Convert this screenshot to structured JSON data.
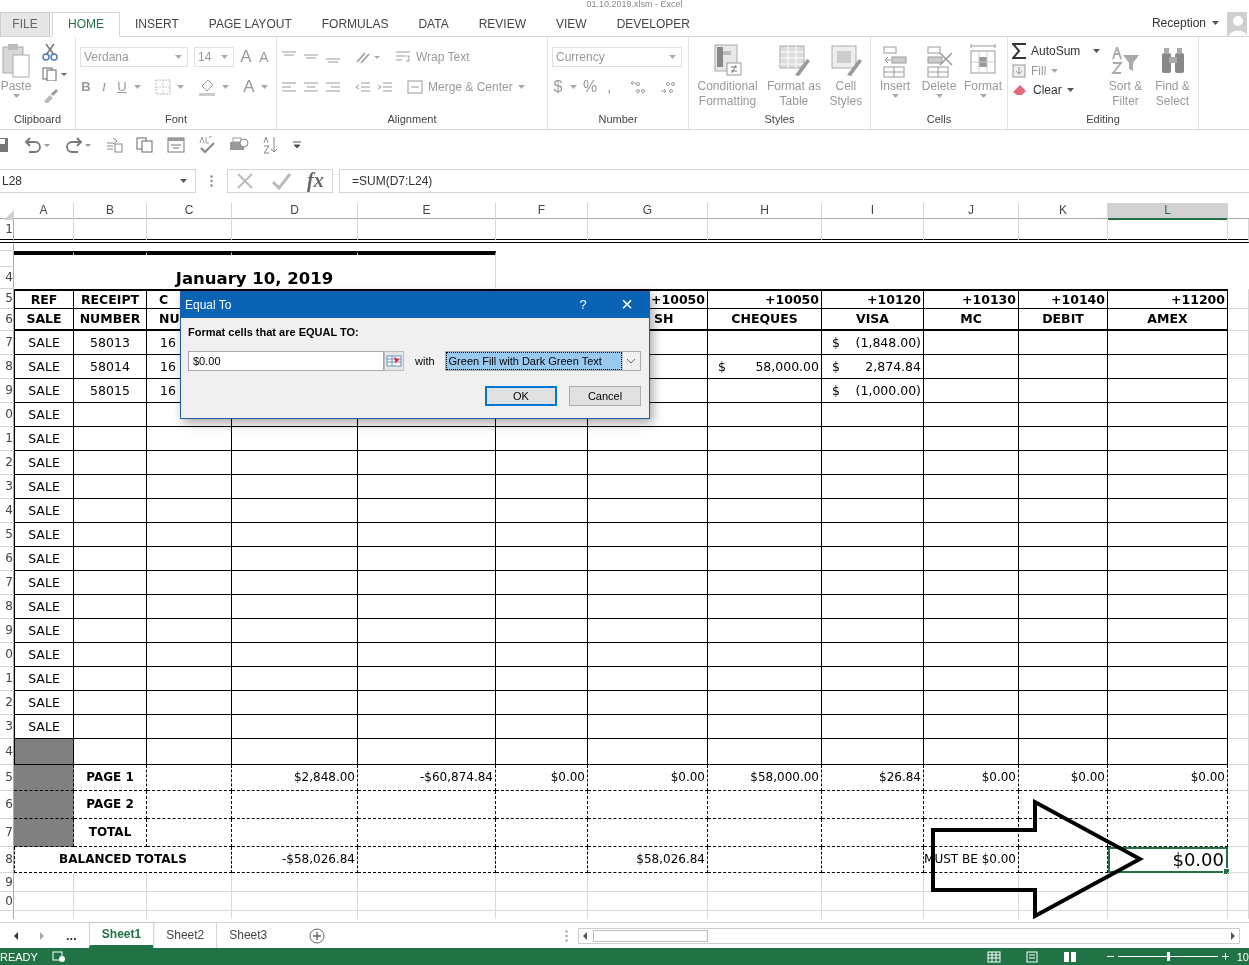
{
  "title_bar": {
    "title": "01.10.2019.xlsm - Excel"
  },
  "tabs": [
    {
      "label": "FILE",
      "selected": false
    },
    {
      "label": "HOME",
      "selected": true
    },
    {
      "label": "INSERT",
      "selected": false
    },
    {
      "label": "PAGE LAYOUT",
      "selected": false
    },
    {
      "label": "FORMULAS",
      "selected": false
    },
    {
      "label": "DATA",
      "selected": false
    },
    {
      "label": "REVIEW",
      "selected": false
    },
    {
      "label": "VIEW",
      "selected": false
    },
    {
      "label": "DEVELOPER",
      "selected": false
    }
  ],
  "account": {
    "name": "Reception"
  },
  "ribbon": {
    "clipboard": {
      "label": "Clipboard",
      "paste": "Paste"
    },
    "font": {
      "label": "Font",
      "family": "Verdana",
      "size": "14",
      "grow": "A",
      "shrink": "A",
      "bold": "B",
      "italic": "I",
      "underline": "U",
      "swatch_letter": "A"
    },
    "alignment": {
      "label": "Alignment",
      "wrap": "Wrap Text",
      "merge": "Merge & Center"
    },
    "number": {
      "label": "Number",
      "format": "Currency",
      "currency": "$",
      "percent": "%",
      "comma": ","
    },
    "styles": {
      "label": "Styles",
      "conditional": "Conditional Formatting",
      "table": "Format as Table",
      "cell_styles": "Cell Styles"
    },
    "cells": {
      "label": "Cells",
      "insert": "Insert",
      "delete": "Delete",
      "format": "Format"
    },
    "editing": {
      "label": "Editing",
      "autosum": "AutoSum",
      "fill": "Fill",
      "clear": "Clear",
      "sort": "Sort & Filter",
      "find": "Find & Select"
    }
  },
  "formula_bar": {
    "name_box": "L28",
    "fx": "fx",
    "formula": "=SUM(D7:L24)"
  },
  "columns": [
    {
      "label": "A",
      "selected": false
    },
    {
      "label": "B",
      "selected": false
    },
    {
      "label": "C",
      "selected": false
    },
    {
      "label": "D",
      "selected": false
    },
    {
      "label": "E",
      "selected": false
    },
    {
      "label": "F",
      "selected": false
    },
    {
      "label": "G",
      "selected": false
    },
    {
      "label": "H",
      "selected": false
    },
    {
      "label": "I",
      "selected": false
    },
    {
      "label": "J",
      "selected": false
    },
    {
      "label": "K",
      "selected": false
    },
    {
      "label": "L",
      "selected": true
    }
  ],
  "rows": [
    {
      "label": "1",
      "kind": "blank"
    },
    {
      "kind": "spacer"
    },
    {
      "kind": "rule"
    },
    {
      "label": "4",
      "kind": "title",
      "cells": [
        "January 10, 2019"
      ]
    },
    {
      "label": "5",
      "kind": "codes",
      "cells": [
        "REF",
        "RECEIPT",
        "C",
        null,
        null,
        null,
        "+10050",
        "+10050",
        "+10120",
        "+10130",
        "+10140",
        "+11200"
      ]
    },
    {
      "label": "6",
      "kind": "names",
      "cells": [
        "SALE",
        "NUMBER",
        "NU",
        null,
        null,
        null,
        "SH",
        "CHEQUES",
        "VISA",
        "MC",
        "DEBIT",
        "AMEX"
      ]
    },
    {
      "label": "7",
      "kind": "data",
      "cells": [
        "SALE",
        "58013",
        "16",
        null,
        null,
        null,
        null,
        null,
        {
          "symbol": "$",
          "amount": "(1,848.00)"
        }
      ]
    },
    {
      "label": "8",
      "kind": "data",
      "cells": [
        "SALE",
        "58014",
        "16",
        null,
        null,
        null,
        null,
        {
          "symbol": "$",
          "amount": "58,000.00"
        },
        {
          "symbol": "$",
          "amount": "2,874.84"
        }
      ]
    },
    {
      "label": "9",
      "kind": "data",
      "cells": [
        "SALE",
        "58015",
        "16",
        null,
        null,
        null,
        null,
        null,
        {
          "symbol": "$",
          "amount": "(1,000.00)"
        }
      ]
    },
    {
      "label": "0",
      "kind": "data",
      "cells": [
        "SALE"
      ]
    },
    {
      "label": "1",
      "kind": "data",
      "cells": [
        "SALE"
      ]
    },
    {
      "label": "2",
      "kind": "data",
      "cells": [
        "SALE"
      ]
    },
    {
      "label": "3",
      "kind": "data",
      "cells": [
        "SALE"
      ]
    },
    {
      "label": "4",
      "kind": "data",
      "cells": [
        "SALE"
      ]
    },
    {
      "label": "5",
      "kind": "data",
      "cells": [
        "SALE"
      ]
    },
    {
      "label": "6",
      "kind": "data",
      "cells": [
        "SALE"
      ]
    },
    {
      "label": "7",
      "kind": "data",
      "cells": [
        "SALE"
      ]
    },
    {
      "label": "8",
      "kind": "data",
      "cells": [
        "SALE"
      ]
    },
    {
      "label": "9",
      "kind": "data",
      "cells": [
        "SALE"
      ]
    },
    {
      "label": "0",
      "kind": "data",
      "cells": [
        "SALE"
      ]
    },
    {
      "label": "1",
      "kind": "data",
      "cells": [
        "SALE"
      ]
    },
    {
      "label": "2",
      "kind": "data",
      "cells": [
        "SALE"
      ]
    },
    {
      "label": "3",
      "kind": "data",
      "cells": [
        "SALE"
      ]
    },
    {
      "label": "4",
      "kind": "shaded"
    },
    {
      "label": "5",
      "kind": "total",
      "cells": [
        null,
        "PAGE 1",
        null,
        "$2,848.00",
        "-$60,874.84",
        "$0.00",
        "$0.00",
        "$58,000.00",
        "$26.84",
        "$0.00",
        "$0.00",
        "$0.00"
      ]
    },
    {
      "label": "6",
      "kind": "total",
      "cells": [
        null,
        "PAGE 2"
      ]
    },
    {
      "label": "7",
      "kind": "total",
      "cells": [
        null,
        "TOTAL"
      ]
    },
    {
      "label": "8",
      "kind": "balanced",
      "cells": [
        "BALANCED TOTALS",
        null,
        null,
        "-$58,026.84",
        null,
        null,
        "$58,026.84",
        null,
        null,
        "MUST BE $0.00",
        null,
        {
          "text": "$0.00",
          "selected": true
        }
      ]
    },
    {
      "label": "9",
      "kind": "empty"
    },
    {
      "label": "0",
      "kind": "empty"
    },
    {
      "kind": "partial"
    }
  ],
  "dialog": {
    "title": "Equal To",
    "help": "?",
    "close": "×",
    "prompt": "Format cells that are EQUAL TO:",
    "value": "$0.00",
    "with": "with",
    "format": "Green Fill with Dark Green Text",
    "ok": "OK",
    "cancel": "Cancel"
  },
  "sheet_nav": {
    "more": "..."
  },
  "sheet_tabs": [
    {
      "label": "Sheet1",
      "selected": true
    },
    {
      "label": "Sheet2",
      "selected": false
    },
    {
      "label": "Sheet3",
      "selected": false
    }
  ],
  "status_bar": {
    "mode": "READY",
    "zoom": "10",
    "zoom_slider": {
      "level": 0.5
    }
  }
}
